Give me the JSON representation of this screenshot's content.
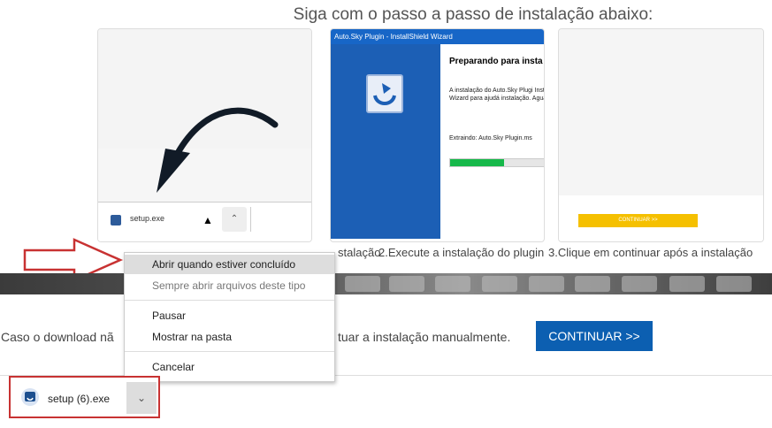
{
  "heading": "Siga com o passo a passo de instalação abaixo:",
  "step1": {
    "file_name": "setup.exe"
  },
  "step2": {
    "window_title": "Auto.Sky Plugin - InstallShield Wizard",
    "heading": "Preparando para insta",
    "body": "A instalação do Auto.Sky Plugi InstallShield Wizard para ajudá instalação.  Aguarde.",
    "extracting": "Extraindo: Auto.Sky Plugin.ms",
    "progress": 0.52
  },
  "step3": {
    "button": "CONTINUAR >>"
  },
  "captions": {
    "c1": "stalação",
    "c2": "2.Execute a instalação do plugin",
    "c3": "3.Clique em continuar após a instalação"
  },
  "manual": {
    "left": "Caso o download nã",
    "right": "tuar a instalação manualmente.",
    "button": "CONTINUAR >>"
  },
  "menu": {
    "items": [
      "Abrir quando estiver concluído",
      "Sempre abrir arquivos deste tipo",
      "Pausar",
      "Mostrar na pasta",
      "Cancelar"
    ]
  },
  "download": {
    "file_name": "setup (6).exe"
  },
  "colors": {
    "accent": "#0c5fb1",
    "highlight": "#c83232",
    "progress": "#16b84a"
  }
}
